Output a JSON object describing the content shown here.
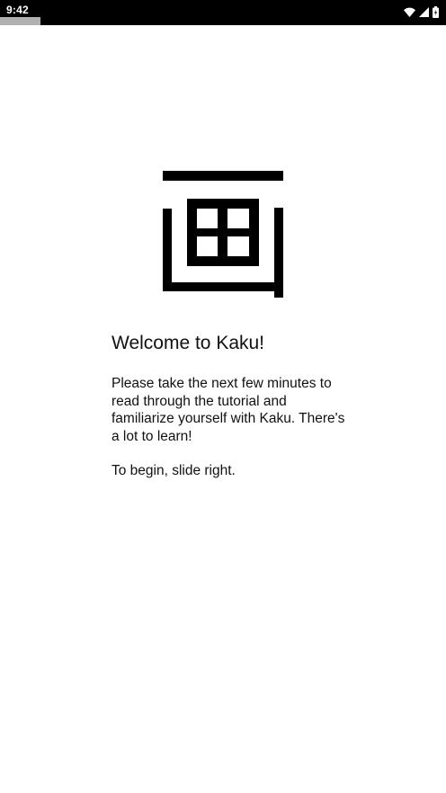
{
  "status_bar": {
    "time": "9:42",
    "icons": [
      "wifi-icon",
      "cell-signal-icon",
      "battery-icon"
    ]
  },
  "progress": {
    "fraction": 0.09,
    "color": "#b0b0b0"
  },
  "welcome": {
    "title": "Welcome to Kaku!",
    "paragraph_1": "Please take the next few minutes to read through the tutorial and familiarize yourself with Kaku. There's a lot to learn!",
    "paragraph_2": "To begin, slide right."
  },
  "colors": {
    "background": "#ffffff",
    "status_bar": "#000000",
    "logo": "#000000"
  }
}
